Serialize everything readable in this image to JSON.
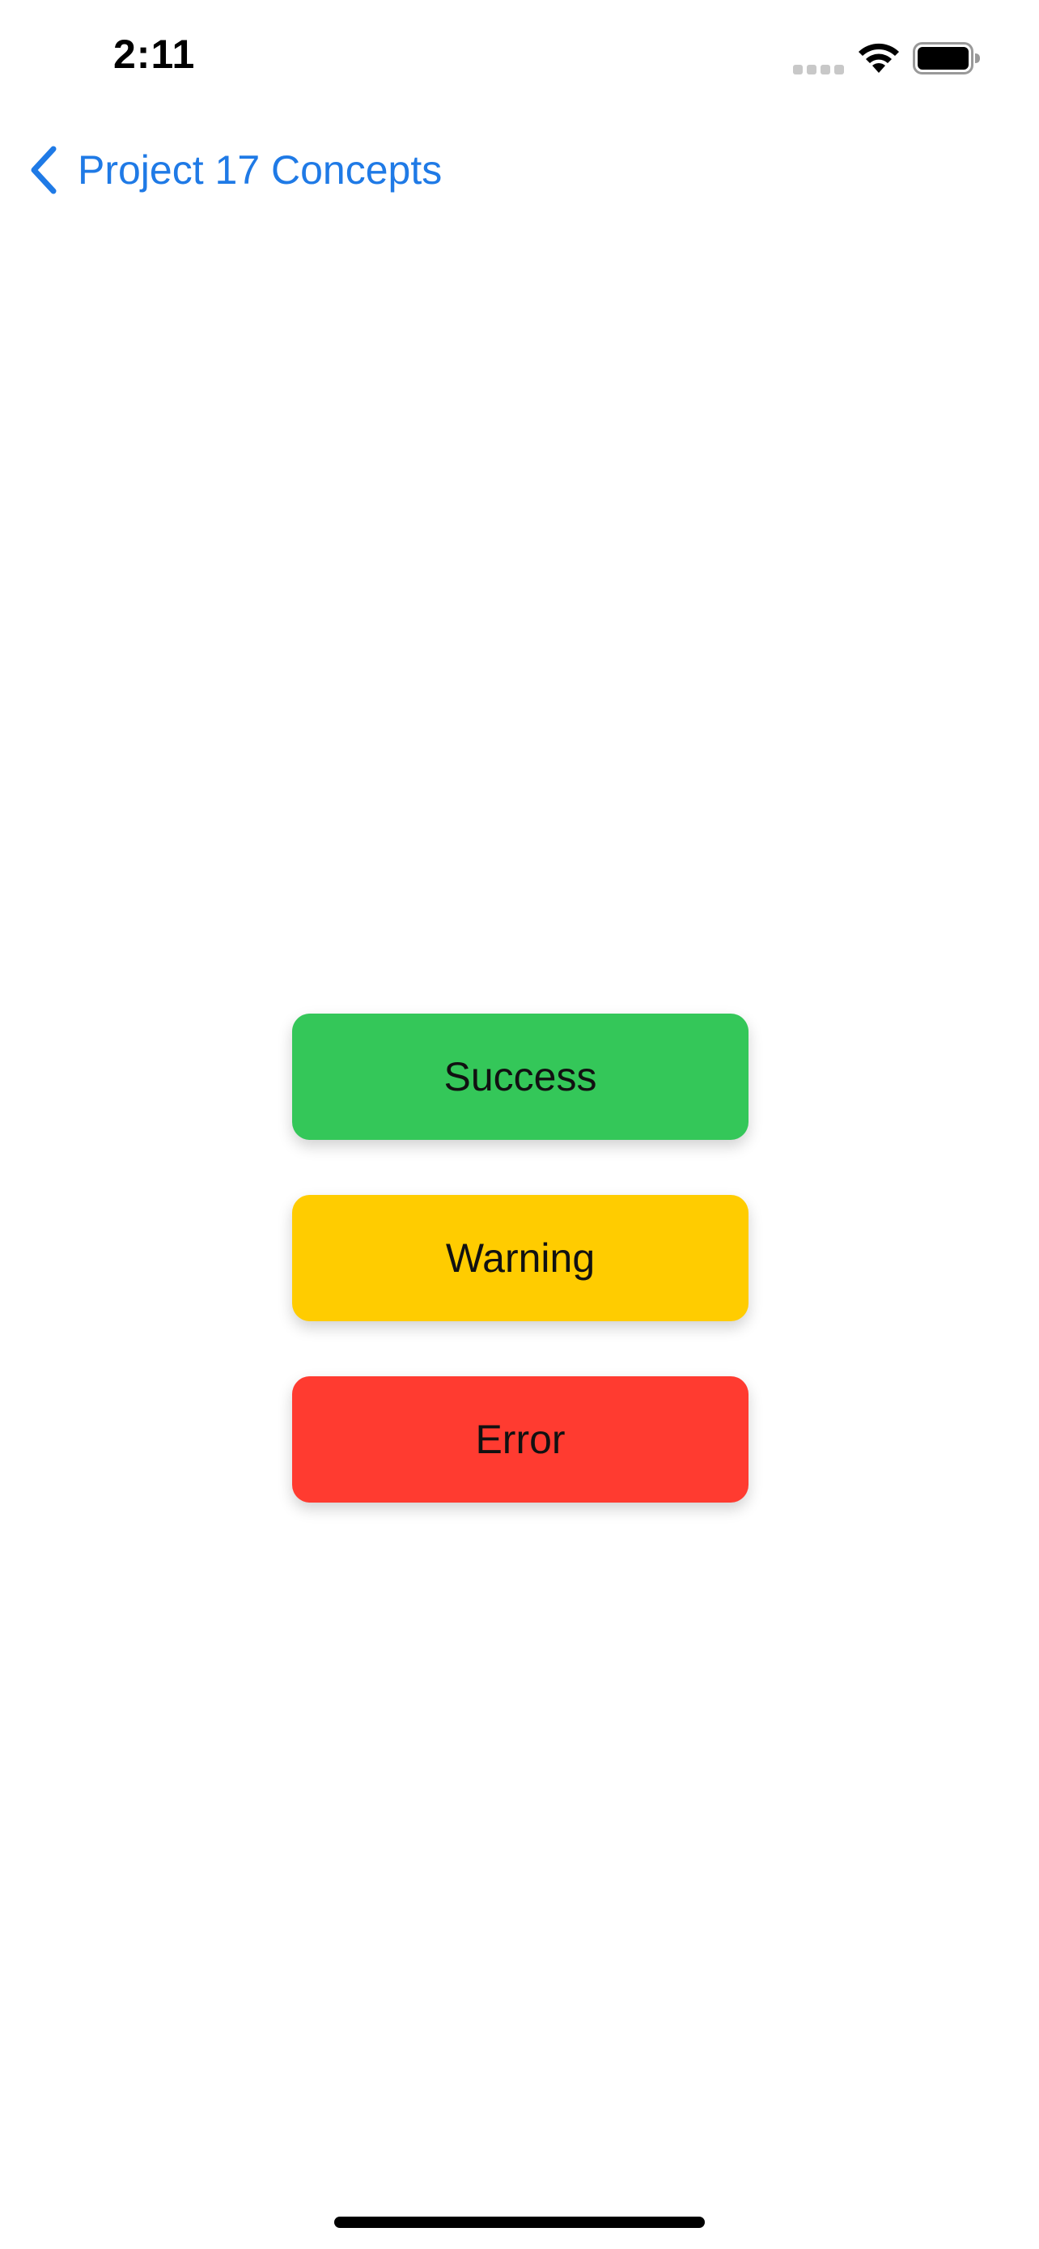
{
  "status_bar": {
    "time": "2:11",
    "icons": [
      "signal-icon",
      "wifi-icon",
      "battery-icon"
    ]
  },
  "nav": {
    "back_label": "Project 17 Concepts",
    "icon": "chevron-left-icon",
    "tint": "#1f7ae6"
  },
  "buttons": [
    {
      "label": "Success",
      "color": "#34c759"
    },
    {
      "label": "Warning",
      "color": "#ffcc00"
    },
    {
      "label": "Error",
      "color": "#ff3b30"
    }
  ]
}
